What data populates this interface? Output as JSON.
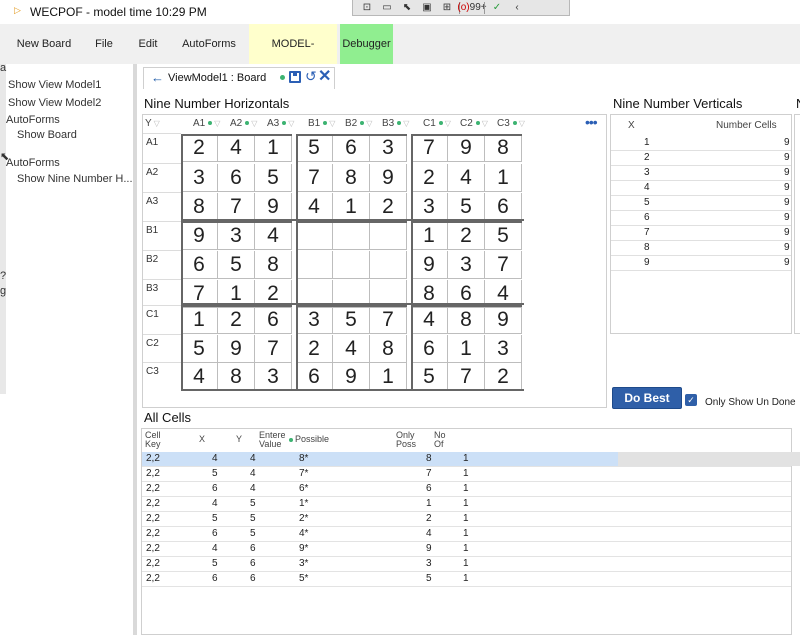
{
  "window": {
    "title": "WECPOF - model time 10:29 PM"
  },
  "overlay_toolbar": {
    "count": "99+"
  },
  "menu": {
    "new_board": "New Board",
    "file": "File",
    "edit": "Edit",
    "autoforms": "AutoForms",
    "refresh": "MODEL-REFRESH",
    "debugger": "Debugger"
  },
  "sidebar": {
    "items": [
      {
        "label": "Show View Model1"
      },
      {
        "label": "Show View Model2"
      },
      {
        "label": "AutoForms"
      },
      {
        "label": "Show Board"
      },
      {
        "label": "AutoForms"
      },
      {
        "label": "Show Nine Number H..."
      }
    ],
    "edge_glyphs": [
      "a",
      "?",
      "g"
    ]
  },
  "tab": {
    "title": "ViewModel1 : Board"
  },
  "horizontals": {
    "title": "Nine Number Horizontals",
    "corner_header": "Y",
    "columns": [
      "A1",
      "A2",
      "A3",
      "B1",
      "B2",
      "B3",
      "C1",
      "C2",
      "C3"
    ],
    "rows": [
      {
        "label": "A1",
        "cells": [
          "2",
          "4",
          "1",
          "5",
          "6",
          "3",
          "7",
          "9",
          "8"
        ]
      },
      {
        "label": "A2",
        "cells": [
          "3",
          "6",
          "5",
          "7",
          "8",
          "9",
          "2",
          "4",
          "1"
        ]
      },
      {
        "label": "A3",
        "cells": [
          "8",
          "7",
          "9",
          "4",
          "1",
          "2",
          "3",
          "5",
          "6"
        ]
      },
      {
        "label": "B1",
        "cells": [
          "9",
          "3",
          "4",
          "",
          "",
          "",
          "1",
          "2",
          "5"
        ]
      },
      {
        "label": "B2",
        "cells": [
          "6",
          "5",
          "8",
          "",
          "",
          "",
          "9",
          "3",
          "7"
        ]
      },
      {
        "label": "B3",
        "cells": [
          "7",
          "1",
          "2",
          "",
          "",
          "",
          "8",
          "6",
          "4"
        ]
      },
      {
        "label": "C1",
        "cells": [
          "1",
          "2",
          "6",
          "3",
          "5",
          "7",
          "4",
          "8",
          "9"
        ]
      },
      {
        "label": "C2",
        "cells": [
          "5",
          "9",
          "7",
          "2",
          "4",
          "8",
          "6",
          "1",
          "3"
        ]
      },
      {
        "label": "C3",
        "cells": [
          "4",
          "8",
          "3",
          "6",
          "9",
          "1",
          "5",
          "7",
          "2"
        ]
      }
    ]
  },
  "verticals": {
    "title": "Nine Number Verticals",
    "headers": {
      "x": "X",
      "number_cells": "Number Cells"
    },
    "rows": [
      {
        "x": "1",
        "count": "9"
      },
      {
        "x": "2",
        "count": "9"
      },
      {
        "x": "3",
        "count": "9"
      },
      {
        "x": "4",
        "count": "9"
      },
      {
        "x": "5",
        "count": "9"
      },
      {
        "x": "6",
        "count": "9"
      },
      {
        "x": "7",
        "count": "9"
      },
      {
        "x": "8",
        "count": "9"
      },
      {
        "x": "9",
        "count": "9"
      }
    ]
  },
  "third_panel": {
    "title_fragment": "N"
  },
  "actions": {
    "do_best": "Do Best",
    "only_show_un_done": "Only Show Un Done"
  },
  "all_cells": {
    "title": "All Cells",
    "headers": {
      "cell_key": "Cell Key",
      "x": "X",
      "y": "Y",
      "entered": "Entered Value",
      "possible": "Possible",
      "only_poss": "Only Poss",
      "no_of": "No Of"
    },
    "rows": [
      {
        "key": "2,2",
        "x": "4",
        "y": "4",
        "possible": "8*",
        "only": "8",
        "no": "1"
      },
      {
        "key": "2,2",
        "x": "5",
        "y": "4",
        "possible": "7*",
        "only": "7",
        "no": "1"
      },
      {
        "key": "2,2",
        "x": "6",
        "y": "4",
        "possible": "6*",
        "only": "6",
        "no": "1"
      },
      {
        "key": "2,2",
        "x": "4",
        "y": "5",
        "possible": "1*",
        "only": "1",
        "no": "1"
      },
      {
        "key": "2,2",
        "x": "5",
        "y": "5",
        "possible": "2*",
        "only": "2",
        "no": "1"
      },
      {
        "key": "2,2",
        "x": "6",
        "y": "5",
        "possible": "4*",
        "only": "4",
        "no": "1"
      },
      {
        "key": "2,2",
        "x": "4",
        "y": "6",
        "possible": "9*",
        "only": "9",
        "no": "1"
      },
      {
        "key": "2,2",
        "x": "5",
        "y": "6",
        "possible": "3*",
        "only": "3",
        "no": "1"
      },
      {
        "key": "2,2",
        "x": "6",
        "y": "6",
        "possible": "5*",
        "only": "5",
        "no": "1"
      }
    ]
  }
}
